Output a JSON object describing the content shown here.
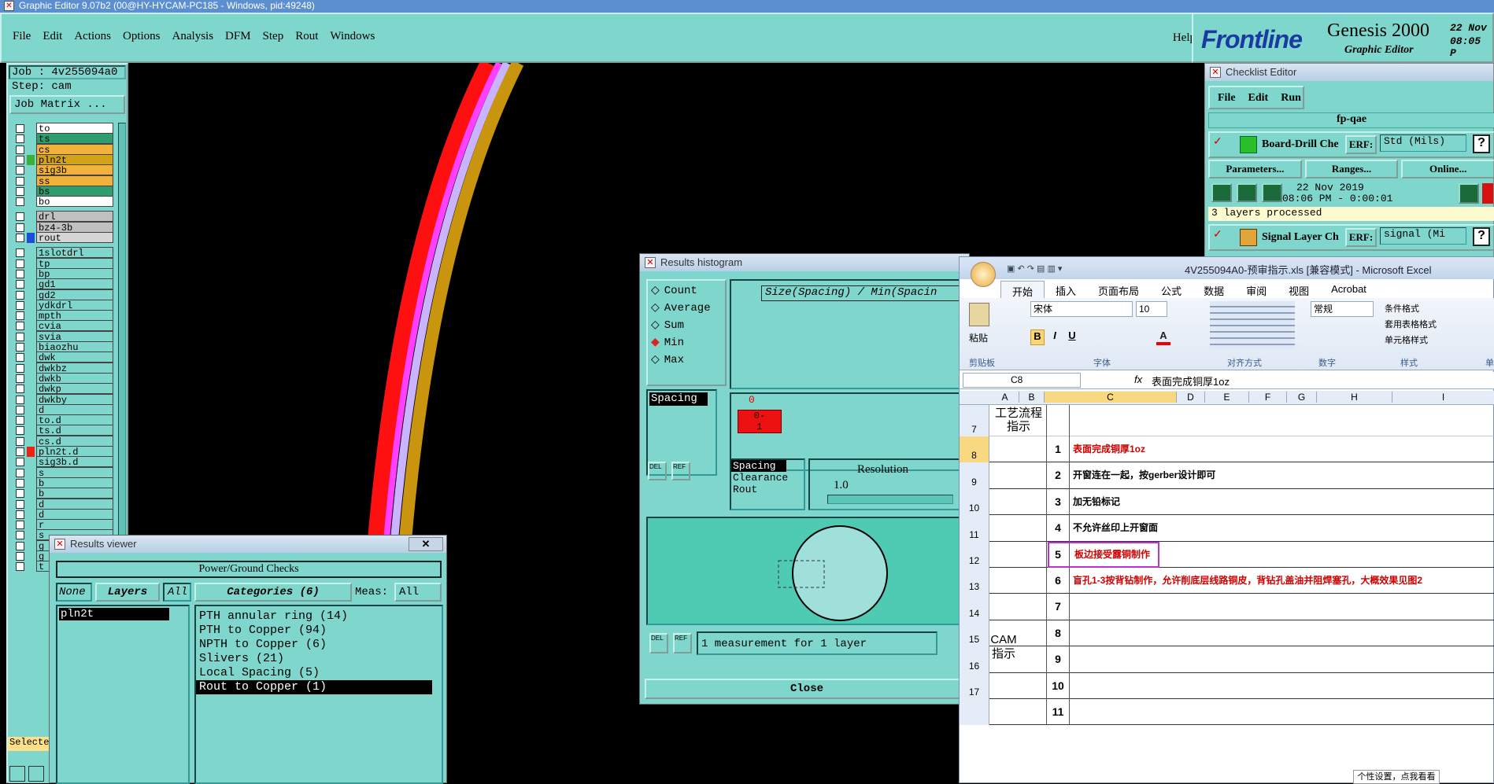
{
  "taskbar_title": "Graphic Editor 9.07b2 (00@HY-HYCAM-PC185 - Windows, pid:49248)",
  "menu": [
    "File",
    "Edit",
    "Actions",
    "Options",
    "Analysis",
    "DFM",
    "Step",
    "Rout",
    "Windows"
  ],
  "help": "Help",
  "brand": {
    "logo": "Frontline",
    "product": "Genesis 2000",
    "sub": "Graphic Editor",
    "date": "22 Nov",
    "time": "08:05 P"
  },
  "left_panel": {
    "job": "Job : 4v255094a0",
    "step": "Step: cam",
    "job_matrix": "Job Matrix ...",
    "selected": "Selecte"
  },
  "layers_group1": [
    {
      "name": "to",
      "color": "#ffffff"
    },
    {
      "name": "ts",
      "color": "#2f9e6e"
    },
    {
      "name": "cs",
      "color": "#f2b13a"
    },
    {
      "name": "pln2t",
      "color": "#d4a215",
      "swatch": "#3cae3c"
    },
    {
      "name": "sig3b",
      "color": "#f2b13a"
    },
    {
      "name": "ss",
      "color": "#f2b13a"
    },
    {
      "name": "bs",
      "color": "#2f9e6e"
    },
    {
      "name": "bo",
      "color": "#ffffff"
    }
  ],
  "layers_group2": [
    {
      "name": "drl",
      "color": "#c0c0c0"
    },
    {
      "name": "bz4-3b",
      "color": "#c0c0c0"
    },
    {
      "name": "rout",
      "color": "#d6d6d6",
      "swatch": "#1c4ed8"
    }
  ],
  "layers_group3": [
    "1slotdrl",
    "tp",
    "bp",
    "gd1",
    "gd2",
    "ydkdrl",
    "mpth",
    "cvia",
    "svia",
    "biaozhu",
    "dwk",
    "dwkbz",
    "dwkb",
    "dwkp",
    "dwkby",
    "d",
    "to.d",
    "ts.d",
    "cs.d",
    "pln2t.d",
    "sig3b.d",
    "s",
    "b",
    "b",
    "d",
    "d",
    "r",
    "s",
    "g",
    "g",
    "t"
  ],
  "checklist": {
    "title": "Checklist Editor",
    "menu": [
      "File",
      "Edit",
      "Run"
    ],
    "name": "fp-qae",
    "item1": {
      "label": "Board-Drill Che",
      "erf": "ERF:",
      "value": "Std (Mils)",
      "q": "?"
    },
    "buttons": [
      "Parameters...",
      "Ranges...",
      "Online..."
    ],
    "date": "22 Nov 2019",
    "time": "08:06 PM - 0:00:01",
    "status": "3 layers processed",
    "item2": {
      "label": "Signal Layer Ch",
      "erf": "ERF:",
      "value": "signal (Mi",
      "q": "?"
    }
  },
  "histogram": {
    "title": "Results histogram",
    "options": [
      "Count",
      "Average",
      "Sum",
      "Min",
      "Max"
    ],
    "selected": "Min",
    "chart_title": "Size(Spacing) / Min(Spacin",
    "list_sel": "Spacing",
    "bin_top": "0",
    "bin_label": "0-\n1",
    "types": [
      "Spacing",
      "Clearance",
      "Rout"
    ],
    "resolution_label": "Resolution",
    "resolution_value": "1.0",
    "del": "DEL",
    "ref": "REF",
    "measure": "1 measurement for 1 layer",
    "close": "Close"
  },
  "viewer": {
    "title": "Results viewer",
    "header": "Power/Ground Checks",
    "none": "None",
    "layers": "Layers",
    "all": "All",
    "categories_label": "Categories (6)",
    "meas": "Meas:",
    "meas_val": "All",
    "layer_sel": "pln2t",
    "categories": [
      "PTH annular ring (14)",
      "PTH to Copper (94)",
      "NPTH to Copper (6)",
      "Slivers (21)",
      "Local Spacing (5)",
      "Rout to Copper (1)"
    ],
    "selected_index": 5
  },
  "excel": {
    "title": "4V255094A0-预审指示.xls  [兼容模式] - Microsoft Excel",
    "tabs": [
      "开始",
      "插入",
      "页面布局",
      "公式",
      "数据",
      "审阅",
      "视图",
      "Acrobat"
    ],
    "font": "宋体",
    "size": "10",
    "numfmt": "常规",
    "paste": "粘贴",
    "groups": [
      "剪贴板",
      "字体",
      "对齐方式",
      "数字",
      "样式",
      "单"
    ],
    "styles": [
      "条件格式",
      "套用表格格式",
      "单元格样式"
    ],
    "cellref": "C8",
    "formula": "表面完成铜厚1oz",
    "fx": "fx",
    "cols": [
      "A",
      "B",
      "C",
      "D",
      "E",
      "F",
      "G",
      "H",
      "I"
    ],
    "rows": [
      {
        "n": "7",
        "a": "工艺流程指示",
        "b": "",
        "c": ""
      },
      {
        "n": "8",
        "b": "1",
        "c": "表面完成铜厚1oz",
        "red": true
      },
      {
        "n": "9",
        "b": "2",
        "c": "开窗连在一起，按gerber设计即可"
      },
      {
        "n": "10",
        "b": "3",
        "c": "加无铅标记"
      },
      {
        "n": "11",
        "b": "4",
        "c": "不允许丝印上开窗面"
      },
      {
        "n": "12",
        "b": "5",
        "c": "板边接受露铜制作",
        "red": true,
        "box": true
      },
      {
        "n": "13",
        "b": "6",
        "c": "盲孔1-3按背钻制作，允许削底层线路铜皮，背钻孔盖油并阻焊塞孔，大概效果见图2",
        "red": true
      },
      {
        "n": "14",
        "b": "7",
        "c": ""
      },
      {
        "n": "15",
        "b": "8",
        "c": ""
      },
      {
        "n": "16",
        "b": "9",
        "c": ""
      },
      {
        "n": "17",
        "b": "10",
        "c": ""
      },
      {
        "n": "",
        "b": "11",
        "c": ""
      }
    ],
    "merged_a": "CAM指示",
    "tooltip": "个性设置，点我看看"
  }
}
